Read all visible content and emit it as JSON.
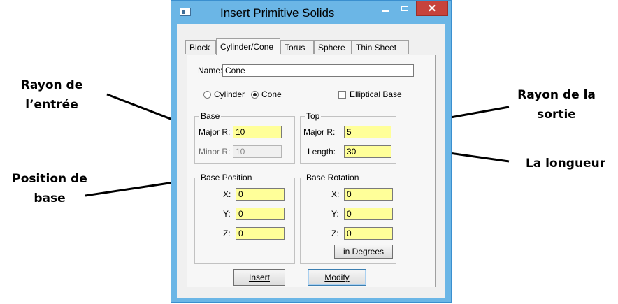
{
  "window": {
    "title": "Insert Primitive Solids",
    "close_glyph": "✕"
  },
  "tabs": [
    "Block",
    "Cylinder/Cone",
    "Torus",
    "Sphere",
    "Thin Sheet"
  ],
  "active_tab": "Cylinder/Cone",
  "name": {
    "label": "Name:",
    "value": "Cone"
  },
  "shape_options": {
    "cylinder_label": "Cylinder",
    "cone_label": "Cone",
    "selected": "Cone",
    "elliptical_label": "Elliptical Base",
    "elliptical_checked": false
  },
  "base": {
    "title": "Base",
    "major_label": "Major R:",
    "major_value": "10",
    "minor_label": "Minor R:",
    "minor_value": "10"
  },
  "top": {
    "title": "Top",
    "major_label": "Major R:",
    "major_value": "5",
    "length_label": "Length:",
    "length_value": "30"
  },
  "base_position": {
    "title": "Base Position",
    "x_label": "X:",
    "x_value": "0",
    "y_label": "Y:",
    "y_value": "0",
    "z_label": "Z:",
    "z_value": "0"
  },
  "base_rotation": {
    "title": "Base Rotation",
    "x_label": "X:",
    "x_value": "0",
    "y_label": "Y:",
    "y_value": "0",
    "z_label": "Z:",
    "z_value": "0",
    "degrees_label": "in Degrees"
  },
  "buttons": {
    "insert": "Insert",
    "modify": "Modify"
  },
  "annotations": {
    "rayon_entree_1": "Rayon de",
    "rayon_entree_2": "l’entrée",
    "position_base_1": "Position de",
    "position_base_2": "base",
    "rayon_sortie_1": "Rayon de la",
    "rayon_sortie_2": "sortie",
    "longueur": "La longueur"
  },
  "colors": {
    "title_bar": "#6bb6e6",
    "close_button": "#c7433c",
    "input_highlight": "#ffff99"
  }
}
